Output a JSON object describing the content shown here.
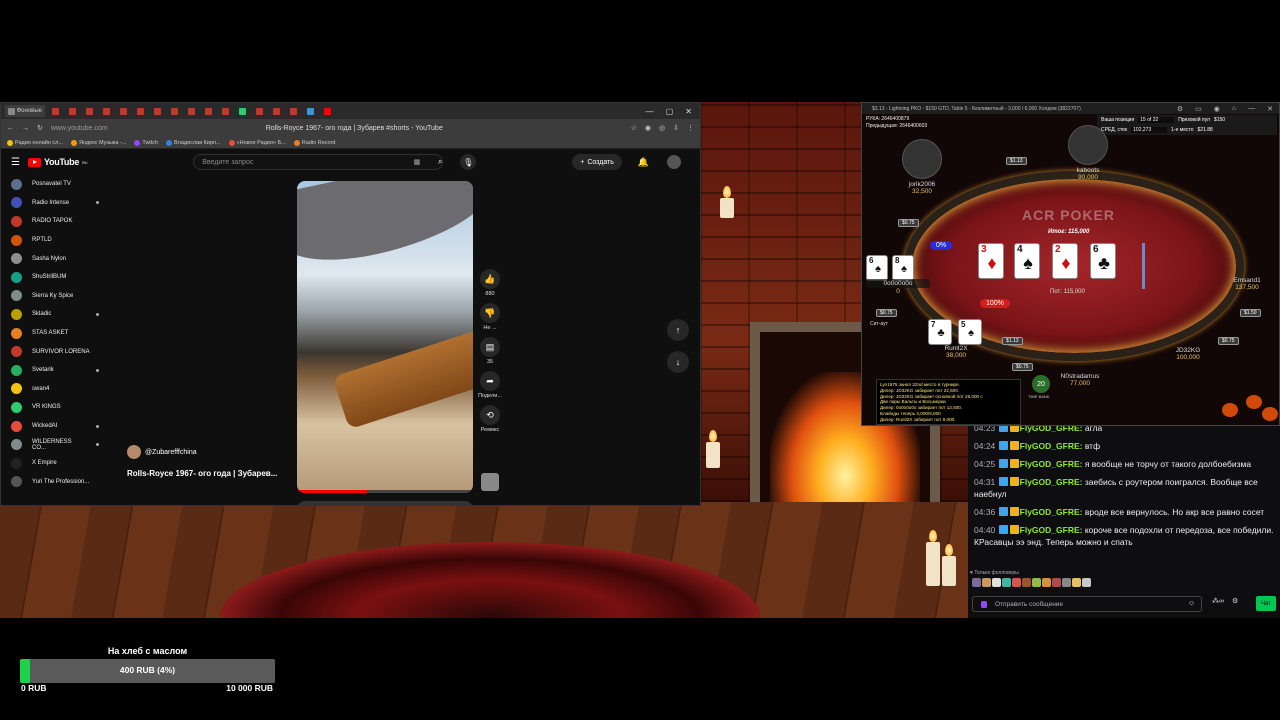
{
  "browser": {
    "tab_title": "Фоновые",
    "url": "www.youtube.com",
    "page_title": "Rolls-Royce 1967- ого года | Зубарев #shorts - YouTube",
    "bookmarks": [
      "Радио онлайн сл...",
      "Яндекс Музыка -...",
      "Twitch",
      "Владислав Кирп...",
      "«Новое Радио» Б...",
      "Radio Record"
    ],
    "window_controls": [
      "—",
      "▢",
      "✕"
    ]
  },
  "youtube": {
    "logo": "YouTube",
    "logo_region": "RU",
    "search_placeholder": "Введите запрос",
    "create_label": "Создать",
    "sidebar": [
      {
        "name": "Posnavatel TV",
        "color": "#5b6e8c",
        "live": false
      },
      {
        "name": "Radio Intense",
        "color": "#3f51b5",
        "live": true
      },
      {
        "name": "RADIO TAPOK",
        "color": "#c0392b",
        "live": false
      },
      {
        "name": "RPTLD",
        "color": "#d35400",
        "live": false
      },
      {
        "name": "Sasha Nylon",
        "color": "#8e8e8e",
        "live": false
      },
      {
        "name": "ShuStrilBUM",
        "color": "#16a085",
        "live": false
      },
      {
        "name": "Sierra Ky Spice",
        "color": "#7f8c8d",
        "live": false
      },
      {
        "name": "Skladic",
        "color": "#b8a000",
        "live": true
      },
      {
        "name": "STAS ASKET",
        "color": "#e67e22",
        "live": false
      },
      {
        "name": "SURVIVOR LORENA",
        "color": "#c0392b",
        "live": false
      },
      {
        "name": "Svetarik",
        "color": "#27ae60",
        "live": true
      },
      {
        "name": "swan4",
        "color": "#f1c40f",
        "live": false
      },
      {
        "name": "VR KINGS",
        "color": "#2ecc71",
        "live": false
      },
      {
        "name": "WickedAI",
        "color": "#e74c3c",
        "live": true
      },
      {
        "name": "WILDERNESS CO...",
        "color": "#7f8c8d",
        "live": true
      },
      {
        "name": "X Empire",
        "color": "#222222",
        "live": false
      },
      {
        "name": "Yuri The Profession...",
        "color": "#555555",
        "live": false
      }
    ],
    "short": {
      "author": "@Zubarefffchina",
      "title": "Rolls-Royce 1967- ого года | Зубарев...",
      "likes": "880",
      "dislike_label": "Не ...",
      "comments": "35",
      "share_label": "Подели...",
      "remix_label": "Ремикс",
      "progress": 0.4
    }
  },
  "poker": {
    "window_title": "$3.13 - Lightning PKO - $150 GTD, Table 5 - Безлимитный - 3,000 / 6,000 Холдем (3822707)",
    "hand_info": [
      "РУКА: 2646400879",
      "Предыдущая: 2646400603"
    ],
    "stats": [
      {
        "label": "Ваша позиция",
        "value": "15 of 22",
        "label2": "Призовой пул",
        "value2": "$150"
      },
      {
        "label": "СРЕД. стек",
        "value": "102,273",
        "label2": "1-е место",
        "value2": "$21.88"
      }
    ],
    "brand": "ACR POKER",
    "total_pot": "Итог: 115,000",
    "pot": "Пот: 115,000",
    "board": [
      {
        "rank": "3",
        "suit": "♦",
        "color": "red"
      },
      {
        "rank": "4",
        "suit": "♠",
        "color": "blk"
      },
      {
        "rank": "2",
        "suit": "♦",
        "color": "red"
      },
      {
        "rank": "6",
        "suit": "♣",
        "color": "blk"
      }
    ],
    "hole_left": [
      {
        "rank": "6",
        "suit": "♠",
        "color": "blk"
      },
      {
        "rank": "8",
        "suit": "♠",
        "color": "blk"
      }
    ],
    "hole_hero": [
      {
        "rank": "7",
        "suit": "♣",
        "color": "blk"
      },
      {
        "rank": "5",
        "suit": "♠",
        "color": "blk"
      }
    ],
    "equity_left": "0%",
    "equity_hero": "100%",
    "seats": {
      "top": {
        "name": "kaboots",
        "stack": "90,000",
        "bounty": "$1.13"
      },
      "top_left": {
        "name": "jorik2006",
        "stack": "32,500",
        "bounty": "$0.75"
      },
      "left": {
        "name": "0o0o0o0o",
        "stack": "0",
        "bounty": "$0.75"
      },
      "hero": {
        "name": "Runit2X",
        "stack": "38,000",
        "bounty": "$1.13"
      },
      "bottom": {
        "name": "N0stradamus",
        "stack": "77,000",
        "bounty": "$0.75"
      },
      "right_bottom": {
        "name": "JD32KG",
        "stack": "100,000",
        "bounty": "$0.75"
      },
      "right": {
        "name": "Emsand1",
        "stack": "137,500",
        "bounty": "$1.50"
      }
    },
    "sitout_label": "Сит-аут",
    "timebank": "20",
    "timebank_label": "TIME BANK",
    "log": [
      "Lyn1975 занял 22nd место в турнире.",
      "Дилер: JD32KG забирает пот 22,500.",
      "Дилер: JD32KG забирает основной пот 26,000 с",
      "Две пары Вальты и Восьмерки.",
      "Дилер: 0o0o0o0o забирает пот 12,500.",
      "Блайнды теперь 3,000/6,000",
      "Дилер: Runit2X забирает пот 9,000."
    ]
  },
  "chat": {
    "messages": [
      {
        "time": "04:23",
        "user": "FlyGOD_GFRE",
        "text": "агла"
      },
      {
        "time": "04:24",
        "user": "FlyGOD_GFRE",
        "text": "втф"
      },
      {
        "time": "04:25",
        "user": "FlyGOD_GFRE",
        "text": "я вообще не торчу от такого долбоебизма"
      },
      {
        "time": "04:31",
        "user": "FlyGOD_GFRE",
        "text": "заебись с роутером поигрался. Вообще все наебнул"
      },
      {
        "time": "04:36",
        "user": "FlyGOD_GFRE",
        "text": "вроде все вернулось. Но акр все равно сосет"
      },
      {
        "time": "04:40",
        "user": "FlyGOD_GFRE",
        "text": "короче все подохли от передоза, все победили. КРасавцы ээ энд. Теперь можно и спать"
      }
    ],
    "followers_only": "Только фолловеры",
    "input_placeholder": "Отправить сообщение",
    "send_label": "Чат"
  },
  "goal": {
    "title": "На хлеб с маслом",
    "current": "400 RUB (4%)",
    "fraction": 0.04,
    "min": "0 RUB",
    "max": "10 000 RUB",
    "fill_color": "#1ed14a"
  }
}
